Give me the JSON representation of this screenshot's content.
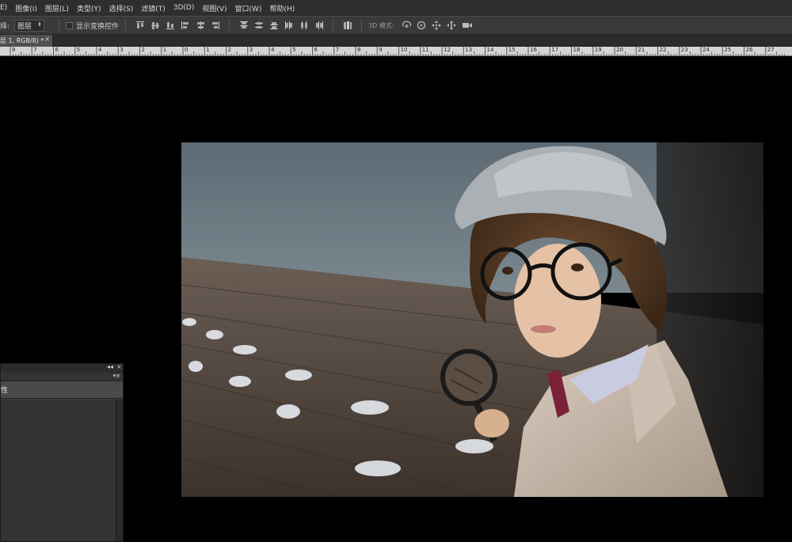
{
  "menu": {
    "items": [
      "E)",
      "图像(I)",
      "图层(L)",
      "类型(Y)",
      "选择(S)",
      "滤镜(T)",
      "3D(D)",
      "视图(V)",
      "窗口(W)",
      "帮助(H)"
    ]
  },
  "options": {
    "tool_label": "择:",
    "target_select": "图层",
    "show_transform_label": "显示变换控件",
    "mode_label": "3D 模式:"
  },
  "document_tab": {
    "title": "层 1, RGB/8) *",
    "close": "×"
  },
  "ruler": {
    "labels": [
      "8",
      "7",
      "6",
      "5",
      "4",
      "3",
      "2",
      "1",
      "0",
      "1",
      "2",
      "3",
      "4",
      "5",
      "6",
      "7",
      "8",
      "9",
      "10",
      "11",
      "12",
      "13",
      "14",
      "15",
      "16",
      "17",
      "18",
      "19",
      "20",
      "21",
      "22",
      "23",
      "24",
      "25",
      "26",
      "27"
    ]
  },
  "panel": {
    "collapse": "◂◂",
    "close": "×",
    "menu": "▾≡",
    "header": "性"
  },
  "colors": {
    "menubar": "#2e2e2e",
    "optionsbar": "#3a3a3a",
    "canvas": "#000000",
    "panel": "#3c3c3c"
  }
}
